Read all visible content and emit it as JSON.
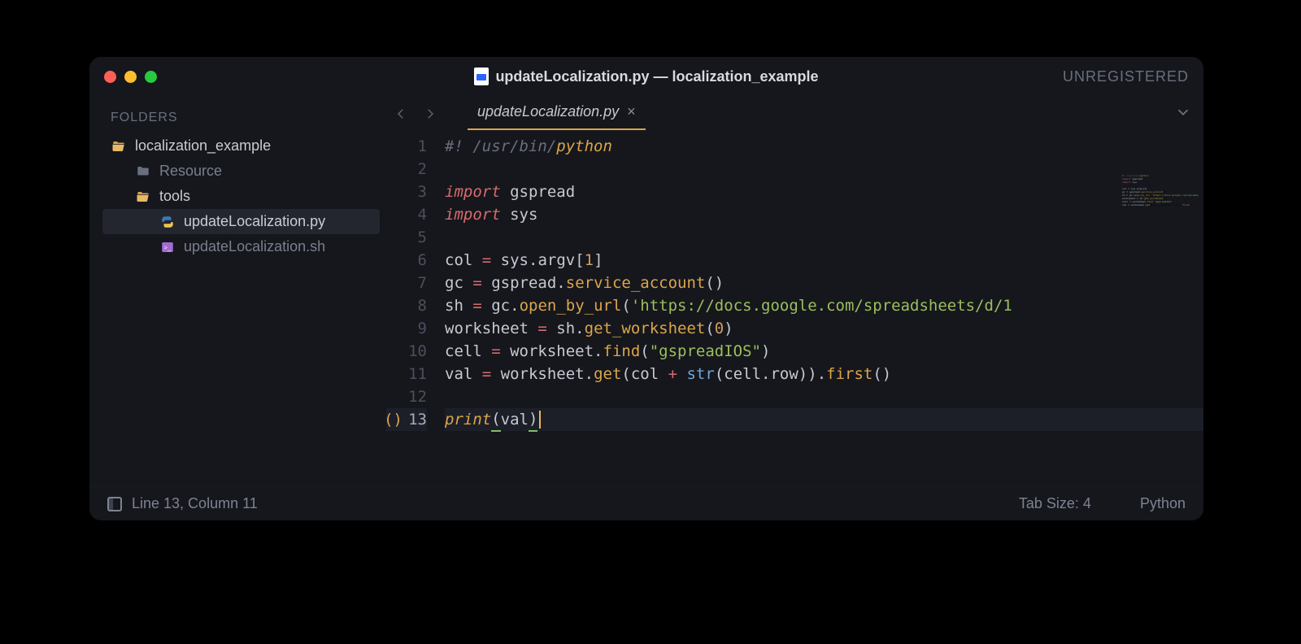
{
  "window": {
    "title_file": "updateLocalization.py",
    "title_sep": " — ",
    "title_project": "localization_example",
    "unregistered_label": "UNREGISTERED"
  },
  "sidebar": {
    "header": "FOLDERS",
    "items": [
      {
        "name": "localization_example",
        "kind": "folder-open",
        "depth": 0
      },
      {
        "name": "Resource",
        "kind": "folder",
        "depth": 1,
        "muted": true
      },
      {
        "name": "tools",
        "kind": "folder-open",
        "depth": 1
      },
      {
        "name": "updateLocalization.py",
        "kind": "python",
        "depth": 2,
        "selected": true
      },
      {
        "name": "updateLocalization.sh",
        "kind": "shell",
        "depth": 2,
        "muted": true
      }
    ]
  },
  "tab": {
    "name": "updateLocalization.py",
    "dirty_italic": true
  },
  "code": {
    "lines": [
      {
        "n": 1,
        "segments": [
          {
            "t": "#! /usr/bin/",
            "c": "c-comment"
          },
          {
            "t": "python",
            "c": "c-shebang-kw"
          }
        ]
      },
      {
        "n": 2,
        "segments": []
      },
      {
        "n": 3,
        "segments": [
          {
            "t": "import ",
            "c": "c-key"
          },
          {
            "t": "gspread",
            "c": "c-mod"
          }
        ]
      },
      {
        "n": 4,
        "segments": [
          {
            "t": "import ",
            "c": "c-key"
          },
          {
            "t": "sys",
            "c": "c-mod"
          }
        ]
      },
      {
        "n": 5,
        "segments": []
      },
      {
        "n": 6,
        "segments": [
          {
            "t": "col ",
            "c": "c-ident"
          },
          {
            "t": "= ",
            "c": "c-op"
          },
          {
            "t": "sys",
            "c": "c-ident"
          },
          {
            "t": ".",
            "c": "c-ident"
          },
          {
            "t": "argv",
            "c": "c-ident"
          },
          {
            "t": "[",
            "c": "c-ident"
          },
          {
            "t": "1",
            "c": "c-num"
          },
          {
            "t": "]",
            "c": "c-ident"
          }
        ]
      },
      {
        "n": 7,
        "segments": [
          {
            "t": "gc ",
            "c": "c-ident"
          },
          {
            "t": "= ",
            "c": "c-op"
          },
          {
            "t": "gspread",
            "c": "c-ident"
          },
          {
            "t": ".",
            "c": "c-ident"
          },
          {
            "t": "service_account",
            "c": "c-fn"
          },
          {
            "t": "()",
            "c": "c-ident"
          }
        ]
      },
      {
        "n": 8,
        "segments": [
          {
            "t": "sh ",
            "c": "c-ident"
          },
          {
            "t": "= ",
            "c": "c-op"
          },
          {
            "t": "gc",
            "c": "c-ident"
          },
          {
            "t": ".",
            "c": "c-ident"
          },
          {
            "t": "open_by_url",
            "c": "c-fn"
          },
          {
            "t": "(",
            "c": "c-ident"
          },
          {
            "t": "'https://docs.google.com/spreadsheets/d/1",
            "c": "c-str"
          }
        ]
      },
      {
        "n": 9,
        "segments": [
          {
            "t": "worksheet ",
            "c": "c-ident"
          },
          {
            "t": "= ",
            "c": "c-op"
          },
          {
            "t": "sh",
            "c": "c-ident"
          },
          {
            "t": ".",
            "c": "c-ident"
          },
          {
            "t": "get_worksheet",
            "c": "c-fn"
          },
          {
            "t": "(",
            "c": "c-ident"
          },
          {
            "t": "0",
            "c": "c-num"
          },
          {
            "t": ")",
            "c": "c-ident"
          }
        ]
      },
      {
        "n": 10,
        "segments": [
          {
            "t": "cell ",
            "c": "c-ident"
          },
          {
            "t": "= ",
            "c": "c-op"
          },
          {
            "t": "worksheet",
            "c": "c-ident"
          },
          {
            "t": ".",
            "c": "c-ident"
          },
          {
            "t": "find",
            "c": "c-fn"
          },
          {
            "t": "(",
            "c": "c-ident"
          },
          {
            "t": "\"gspreadIOS\"",
            "c": "c-str"
          },
          {
            "t": ")",
            "c": "c-ident"
          }
        ]
      },
      {
        "n": 11,
        "segments": [
          {
            "t": "val ",
            "c": "c-ident"
          },
          {
            "t": "= ",
            "c": "c-op"
          },
          {
            "t": "worksheet",
            "c": "c-ident"
          },
          {
            "t": ".",
            "c": "c-ident"
          },
          {
            "t": "get",
            "c": "c-fn"
          },
          {
            "t": "(col ",
            "c": "c-ident"
          },
          {
            "t": "+ ",
            "c": "c-op"
          },
          {
            "t": "str",
            "c": "c-call"
          },
          {
            "t": "(cell",
            "c": "c-ident"
          },
          {
            "t": ".",
            "c": "c-ident"
          },
          {
            "t": "row",
            "c": "c-ident"
          },
          {
            "t": "))",
            "c": "c-ident"
          },
          {
            "t": ".",
            "c": "c-ident"
          },
          {
            "t": "first",
            "c": "c-fn"
          },
          {
            "t": "()",
            "c": "c-ident"
          }
        ]
      },
      {
        "n": 12,
        "segments": []
      },
      {
        "n": 13,
        "current": true,
        "paren_hint": "()",
        "segments": [
          {
            "t": "print",
            "c": "c-builtin"
          },
          {
            "t": "(",
            "c": "c-ident paren-under"
          },
          {
            "t": "val",
            "c": "c-ident"
          },
          {
            "t": ")",
            "c": "c-ident paren-under",
            "cursor_after": true
          }
        ]
      }
    ]
  },
  "status": {
    "position": "Line 13, Column 11",
    "tab_size": "Tab Size: 4",
    "language": "Python"
  }
}
